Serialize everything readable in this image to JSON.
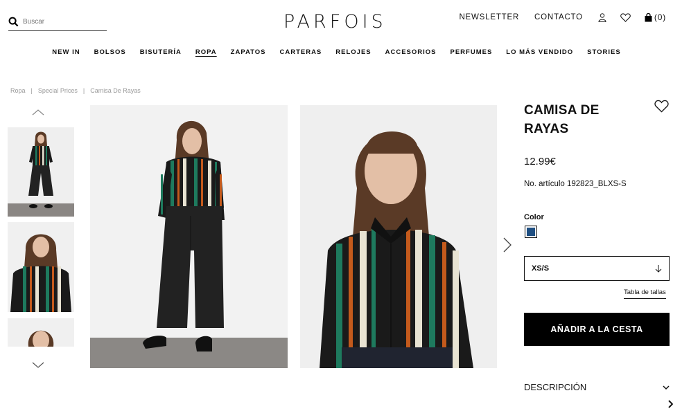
{
  "header": {
    "search_placeholder": "Buscar",
    "logo": "PARFOIS",
    "newsletter": "NEWSLETTER",
    "contact": "CONTACTO",
    "cart_count": "(0)",
    "icons": [
      "search-icon",
      "user-icon",
      "heart-icon",
      "bag-icon"
    ]
  },
  "nav": {
    "items": [
      "NEW IN",
      "BOLSOS",
      "BISUTERÍA",
      "ROPA",
      "ZAPATOS",
      "CARTERAS",
      "RELOJES",
      "ACCESORIOS",
      "PERFUMES",
      "LO MÁS VENDIDO",
      "STORIES"
    ],
    "active": "ROPA"
  },
  "breadcrumb": [
    "Ropa",
    "Special Prices",
    "Camisa De Rayas"
  ],
  "product": {
    "title": "CAMISA DE RAYAS",
    "price": "12.99€",
    "sku": "No. artículo 192823_BLXS-S",
    "color_label": "Color",
    "color_swatch": "#1f4f82",
    "size_selected": "XS/S",
    "size_guide": "Tabla de tallas",
    "add_to_cart": "AÑADIR A LA CESTA",
    "description": "DESCRIPCIÓN"
  },
  "colors": {
    "text": "#111111",
    "button_bg": "#000000",
    "muted": "#999999",
    "shirt_stripes": [
      "#1a1a1a",
      "#1e7a5e",
      "#c45a1c",
      "#e8e3d2"
    ]
  }
}
